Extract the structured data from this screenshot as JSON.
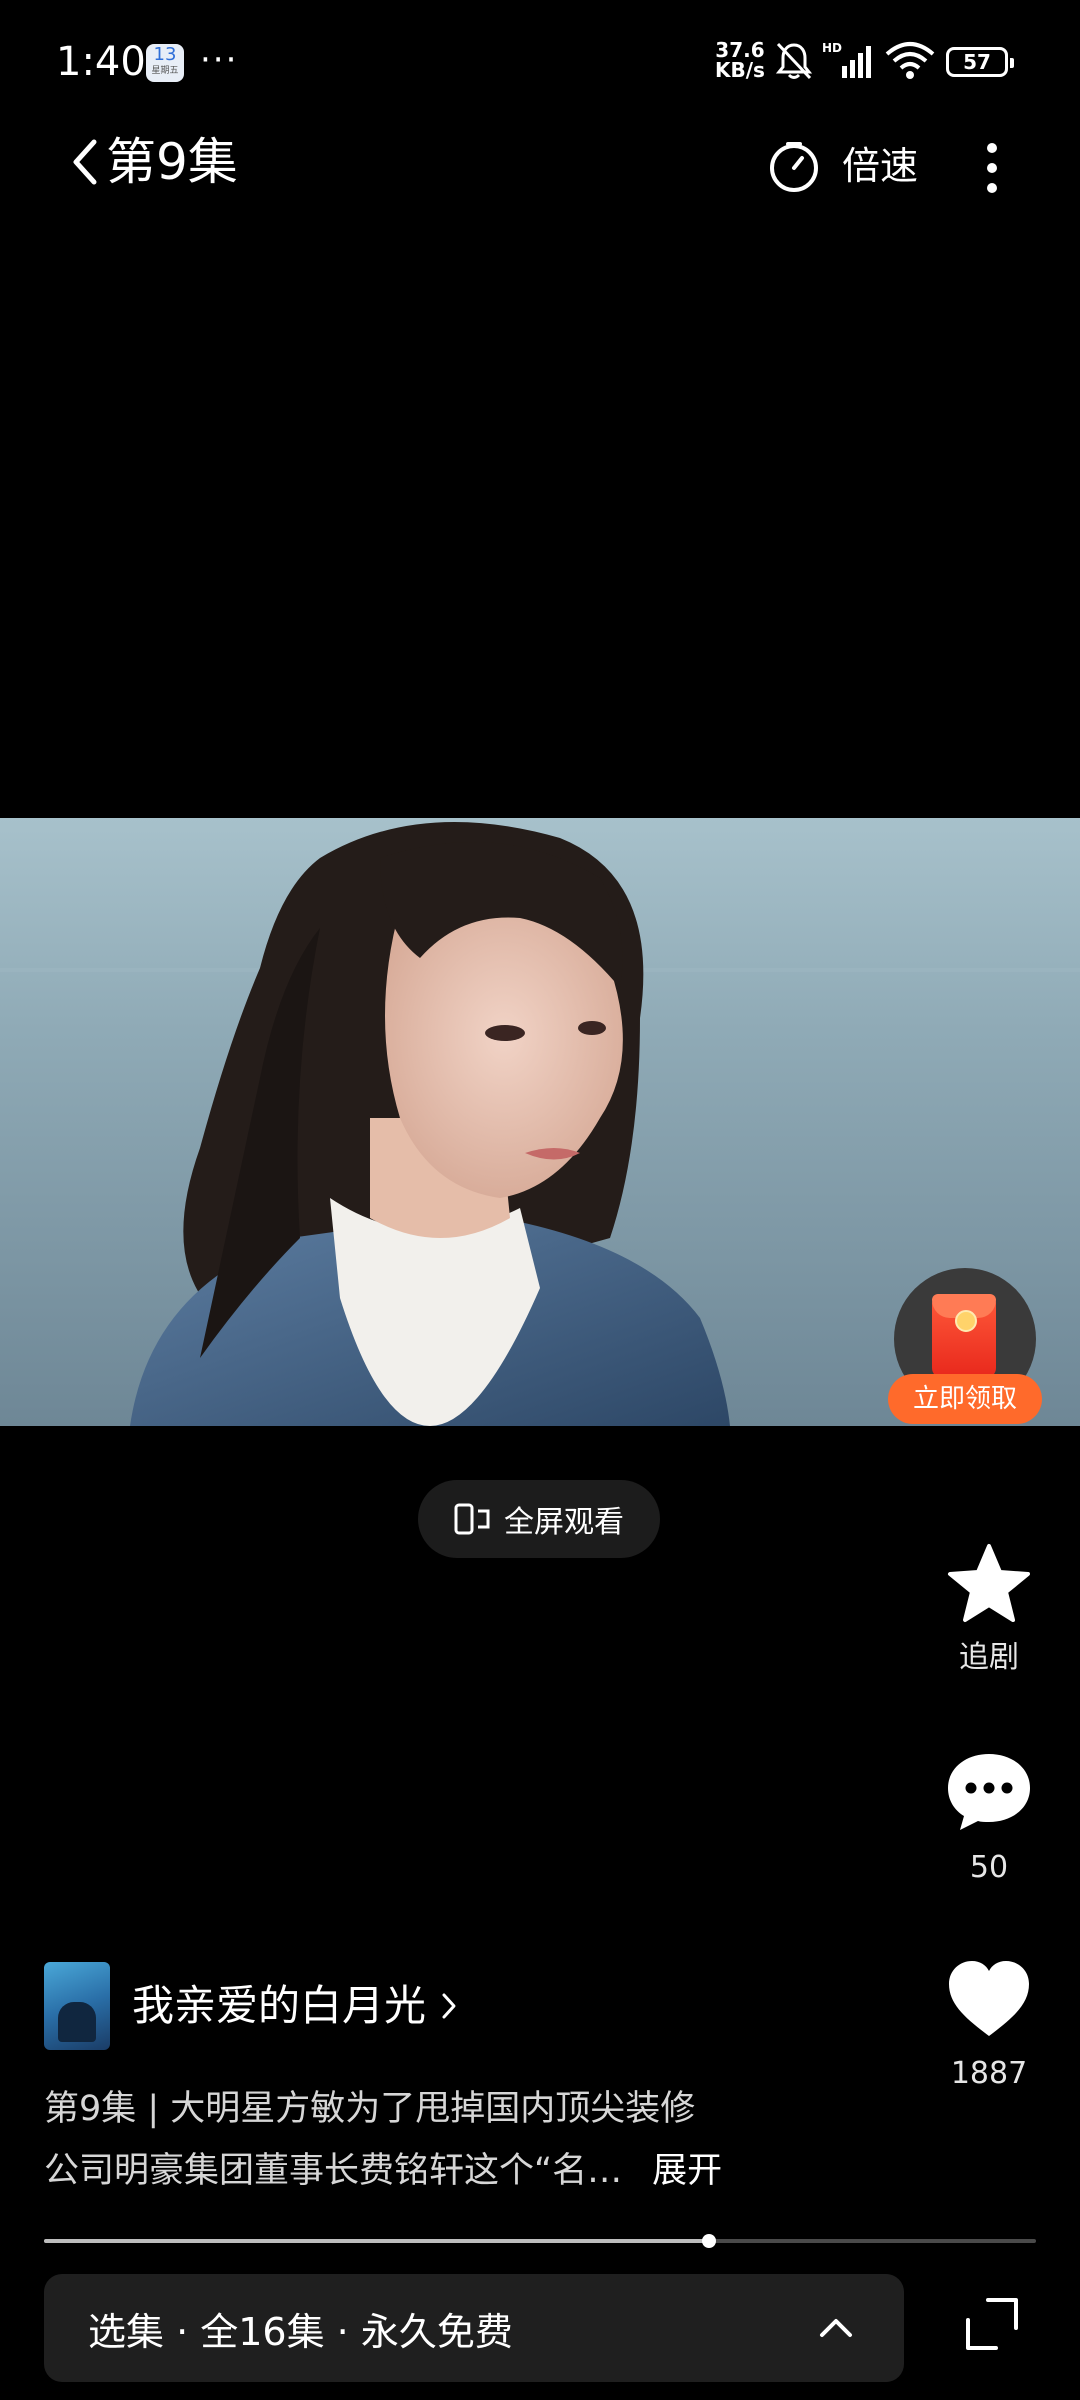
{
  "status_bar": {
    "time": "1:40",
    "calendar_day": "13",
    "calendar_sub": "星期五",
    "more": "···",
    "net_speed_value": "37.6",
    "net_speed_unit": "KB/s",
    "battery": "57"
  },
  "header": {
    "episode_title": "第9集",
    "speed_label": "倍速"
  },
  "red_packet": {
    "claim_label": "立即领取"
  },
  "fullscreen": {
    "label": "全屏观看"
  },
  "actions": {
    "follow_label": "追剧",
    "comment_count": "50",
    "like_count": "1887"
  },
  "drama": {
    "title": "我亲爱的白月光",
    "description_line1": "第9集 | 大明星方敏为了甩掉国内顶尖装修",
    "description_line2": "公司明豪集团董事长费铭轩这个“名…",
    "expand_label": "展开"
  },
  "progress": {
    "fraction": 0.67
  },
  "episode_bar": {
    "text": "选集 · 全16集 · 永久免费"
  },
  "colors": {
    "background": "#000000",
    "accent_orange": "#ff6a2b",
    "bar_bg": "#1f1f1f"
  }
}
